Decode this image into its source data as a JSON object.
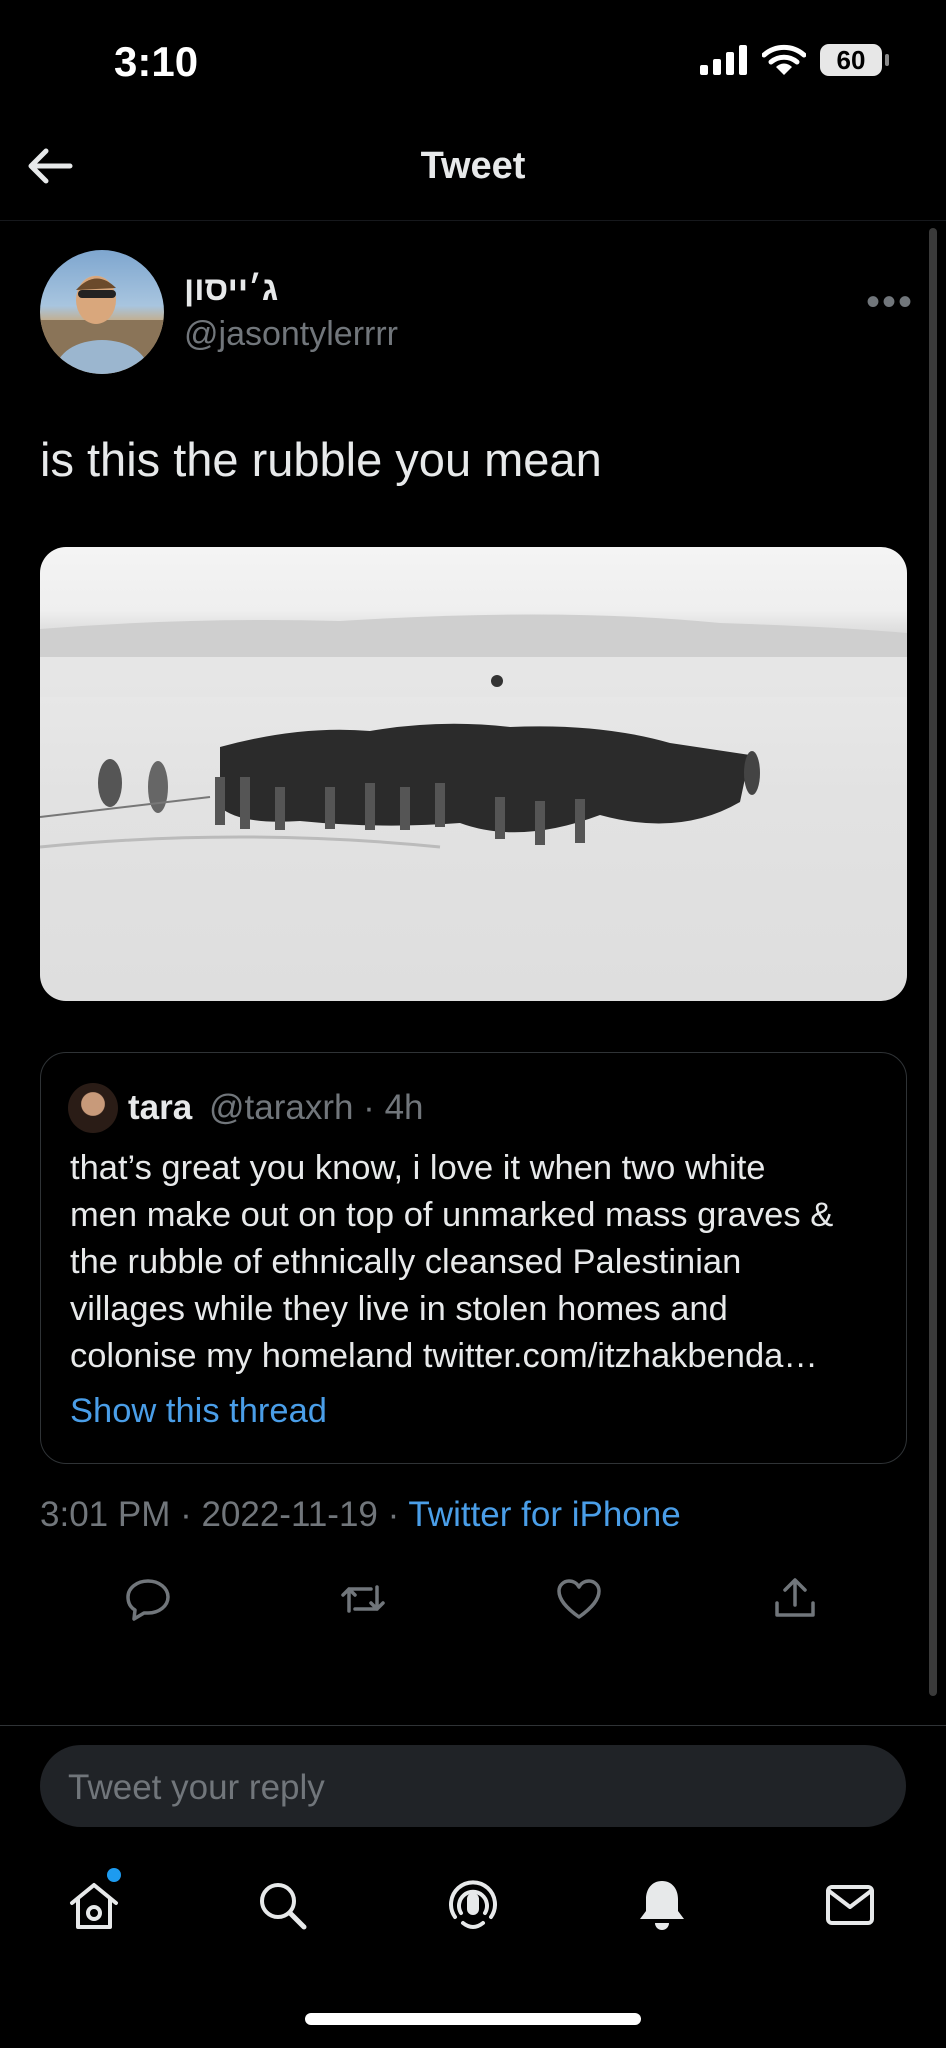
{
  "status_bar": {
    "time": "3:10",
    "battery": "60"
  },
  "header": {
    "title": "Tweet"
  },
  "tweet": {
    "display_name": "ג׳ייסון",
    "handle": "@jasontylerrrr",
    "text": "is this the rubble you mean",
    "timestamp": "3:01 PM · 2022-11-19 · ",
    "source": "Twitter for iPhone"
  },
  "quoted_tweet": {
    "name": "tara",
    "handle": "@taraxrh · 4h",
    "text_lines": [
      "that’s great you know, i love it when two white",
      "men make out on top of unmarked mass graves &",
      "the rubble of ethnically cleansed Palestinian",
      "villages while they live in stolen homes and",
      "colonise my homeland twitter.com/itzhakbenda…"
    ],
    "show_thread": "Show this thread"
  },
  "reply": {
    "placeholder": "Tweet your reply"
  },
  "colors": {
    "accent": "#1d9bf0",
    "link": "#4a9ee8",
    "muted": "#71767b",
    "background": "#000000"
  },
  "icons": {
    "actions": [
      "reply-icon",
      "retweet-icon",
      "like-icon",
      "share-icon"
    ],
    "tabs": [
      "home-icon",
      "search-icon",
      "spaces-icon",
      "notifications-icon",
      "messages-icon"
    ]
  }
}
